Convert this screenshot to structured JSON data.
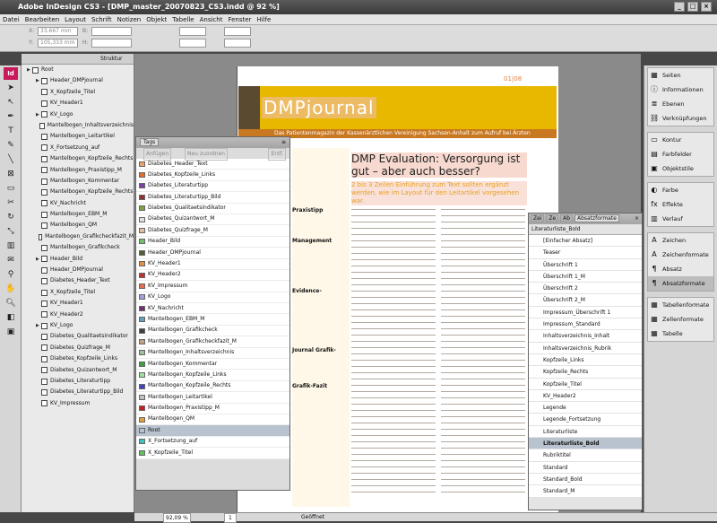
{
  "window": {
    "title": "Adobe InDesign CS3 - [DMP_master_20070823_CS3.indd @ 92 %]"
  },
  "menu": [
    "Datei",
    "Bearbeiten",
    "Layout",
    "Schrift",
    "Notizen",
    "Objekt",
    "Tabelle",
    "Ansicht",
    "Fenster",
    "Hilfe"
  ],
  "control": {
    "x_label": "X:",
    "x_value": "33,667 mm",
    "y_label": "Y:",
    "y_value": "105,333 mm",
    "b_label": "B:",
    "h_label": "H:"
  },
  "structure": {
    "header": "Struktur",
    "items": [
      {
        "label": "Root",
        "level": 0,
        "expand": true
      },
      {
        "label": "Header_DMPjournal",
        "level": 1,
        "expand": true
      },
      {
        "label": "X_Kopfzeile_Titel",
        "level": 1,
        "expand": false
      },
      {
        "label": "KV_Header1",
        "level": 1,
        "expand": false
      },
      {
        "label": "KV_Logo",
        "level": 1,
        "expand": true
      },
      {
        "label": "Mantelbogen_Inhaltsverzeichnis",
        "level": 1,
        "expand": false
      },
      {
        "label": "Mantelbogen_Leitartikel",
        "level": 1,
        "expand": false
      },
      {
        "label": "X_Fortsetzung_auf",
        "level": 1,
        "expand": false
      },
      {
        "label": "Mantelbogen_Kopfzeile_Rechts",
        "level": 1,
        "expand": false
      },
      {
        "label": "Mantelbogen_Praxistipp_M",
        "level": 1,
        "expand": false
      },
      {
        "label": "Mantelbogen_Kommentar",
        "level": 1,
        "expand": false
      },
      {
        "label": "Mantelbogen_Kopfzeile_Rechts",
        "level": 1,
        "expand": false
      },
      {
        "label": "KV_Nachricht",
        "level": 1,
        "expand": false
      },
      {
        "label": "Mantelbogen_EBM_M",
        "level": 1,
        "expand": false
      },
      {
        "label": "Mantelbogen_QM",
        "level": 1,
        "expand": false
      },
      {
        "label": "Mantelbogen_Grafikcheckfazit_M",
        "level": 1,
        "expand": false
      },
      {
        "label": "Mantelbogen_Grafikcheck",
        "level": 1,
        "expand": false
      },
      {
        "label": "Header_Bild",
        "level": 1,
        "expand": true
      },
      {
        "label": "Header_DMPjournal",
        "level": 1,
        "expand": false
      },
      {
        "label": "Diabetes_Header_Text",
        "level": 1,
        "expand": false
      },
      {
        "label": "X_Kopfzeile_Titel",
        "level": 1,
        "expand": false
      },
      {
        "label": "KV_Header1",
        "level": 1,
        "expand": false
      },
      {
        "label": "KV_Header2",
        "level": 1,
        "expand": false
      },
      {
        "label": "KV_Logo",
        "level": 1,
        "expand": true
      },
      {
        "label": "Diabetes_Qualitaetsindikator",
        "level": 1,
        "expand": false
      },
      {
        "label": "Diabetes_Quizfrage_M",
        "level": 1,
        "expand": false
      },
      {
        "label": "Diabetes_Kopfzeile_Links",
        "level": 1,
        "expand": false
      },
      {
        "label": "Diabetes_Quizantwort_M",
        "level": 1,
        "expand": false
      },
      {
        "label": "Diabetes_Literaturtipp",
        "level": 1,
        "expand": false
      },
      {
        "label": "Diabetes_Literaturtipp_Bild",
        "level": 1,
        "expand": false
      },
      {
        "label": "KV_Impressum",
        "level": 1,
        "expand": false
      }
    ]
  },
  "tags": {
    "title": "Tags",
    "add_label": "Anfügen",
    "new_label": "Neu zuordnen",
    "remove_label": "Entf.",
    "items": [
      {
        "label": "Diabetes_Header_Text",
        "color": "#e8a070"
      },
      {
        "label": "Diabetes_Kopfzeile_Links",
        "color": "#e07030"
      },
      {
        "label": "Diabetes_Literaturtipp",
        "color": "#8040a0"
      },
      {
        "label": "Diabetes_Literaturtipp_Bild",
        "color": "#903030"
      },
      {
        "label": "Diabetes_Qualitaetsindikator",
        "color": "#80a040"
      },
      {
        "label": "Diabetes_Quizantwort_M",
        "color": "#e0e0e0"
      },
      {
        "label": "Diabetes_Quizfrage_M",
        "color": "#e0c0a0"
      },
      {
        "label": "Header_Bild",
        "color": "#70c070"
      },
      {
        "label": "Header_DMPjournal",
        "color": "#506030"
      },
      {
        "label": "KV_Header1",
        "color": "#e09040"
      },
      {
        "label": "KV_Header2",
        "color": "#c03030"
      },
      {
        "label": "KV_Impressum",
        "color": "#e07050"
      },
      {
        "label": "KV_Logo",
        "color": "#a0a0e0"
      },
      {
        "label": "KV_Nachricht",
        "color": "#703070"
      },
      {
        "label": "Mantelbogen_EBM_M",
        "color": "#60a0c0"
      },
      {
        "label": "Mantelbogen_Grafikcheck",
        "color": "#404040"
      },
      {
        "label": "Mantelbogen_Grafikcheckfazit_M",
        "color": "#c0a080"
      },
      {
        "label": "Mantelbogen_Inhaltsverzeichnis",
        "color": "#a0c0a0"
      },
      {
        "label": "Mantelbogen_Kommentar",
        "color": "#40a040"
      },
      {
        "label": "Mantelbogen_Kopfzeile_Links",
        "color": "#a0e0a0"
      },
      {
        "label": "Mantelbogen_Kopfzeile_Rechts",
        "color": "#4040c0"
      },
      {
        "label": "Mantelbogen_Leitartikel",
        "color": "#c0c0c0"
      },
      {
        "label": "Mantelbogen_Praxistipp_M",
        "color": "#c02020"
      },
      {
        "label": "Mantelbogen_QM",
        "color": "#e0a040"
      },
      {
        "label": "Root",
        "color": "#b8c3cf"
      },
      {
        "label": "X_Fortsetzung_auf",
        "color": "#40c0c0"
      },
      {
        "label": "X_Kopfzeile_Titel",
        "color": "#60c060"
      }
    ]
  },
  "document": {
    "logo_text": "DMPjournal",
    "page_num": "01|08",
    "band_text": "Das Patientenmagazin der Kassenärztlichen Vereinigung Sachsen-Anhalt zum Aufruf bei Ärzten",
    "headline": "DMP Evaluation: Versorgung ist gut – aber auch besser?",
    "subhead": "2 bis 3 Zeilen Einführung zum Text sollten ergänzt werden, wie im Layout für den Leitartikel vorgesehen war.",
    "side_labels": [
      "Praxistipp",
      "Management",
      "Evidence-",
      "Journal Grafik-",
      "Grafik-Fazit"
    ]
  },
  "absatzformate": {
    "tab1": "Zei",
    "tab2": "Ze",
    "tab3": "Ab",
    "title": "Absatzformate",
    "current": "Literaturliste_Bold",
    "items": [
      {
        "label": "[Einfacher Absatz]",
        "selected": false
      },
      {
        "label": "Teaser",
        "selected": false
      },
      {
        "label": "Überschrift 1",
        "selected": false
      },
      {
        "label": "Überschrift 1_M",
        "selected": false
      },
      {
        "label": "Überschrift 2",
        "selected": false
      },
      {
        "label": "Überschrift 2_M",
        "selected": false
      },
      {
        "label": "Impressum_Überschrift 1",
        "selected": false
      },
      {
        "label": "Impressum_Standard",
        "selected": false
      },
      {
        "label": "Inhaltsverzeichnis_Inhalt",
        "selected": false
      },
      {
        "label": "Inhaltsverzeichnis_Rubrik",
        "selected": false
      },
      {
        "label": "Kopfzeile_Links",
        "selected": false
      },
      {
        "label": "Kopfzeile_Rechts",
        "selected": false
      },
      {
        "label": "Kopfzeile_Titel",
        "selected": false
      },
      {
        "label": "KV_Header2",
        "selected": false
      },
      {
        "label": "Legende",
        "selected": false
      },
      {
        "label": "Legende_Fortsetzung",
        "selected": false
      },
      {
        "label": "Literaturliste",
        "selected": false
      },
      {
        "label": "Literaturliste_Bold",
        "selected": true
      },
      {
        "label": "Rubriktitel",
        "selected": false
      },
      {
        "label": "Standard",
        "selected": false
      },
      {
        "label": "Standard_Bold",
        "selected": false
      },
      {
        "label": "Standard_M",
        "selected": false
      }
    ]
  },
  "panels": [
    {
      "items": [
        {
          "label": "Seiten",
          "icon": "▦"
        },
        {
          "label": "Informationen",
          "icon": "ⓘ"
        },
        {
          "label": "Ebenen",
          "icon": "≣"
        },
        {
          "label": "Verknüpfungen",
          "icon": "⛓"
        }
      ]
    },
    {
      "items": [
        {
          "label": "Kontur",
          "icon": "▭"
        },
        {
          "label": "Farbfelder",
          "icon": "▤"
        },
        {
          "label": "Objektstile",
          "icon": "▣"
        }
      ]
    },
    {
      "items": [
        {
          "label": "Farbe",
          "icon": "◐"
        },
        {
          "label": "Effekte",
          "icon": "fx"
        },
        {
          "label": "Verlauf",
          "icon": "▥"
        }
      ]
    },
    {
      "items": [
        {
          "label": "Zeichen",
          "icon": "A"
        },
        {
          "label": "Zeichenformate",
          "icon": "A"
        },
        {
          "label": "Absatz",
          "icon": "¶"
        },
        {
          "label": "Absatzformate",
          "icon": "¶",
          "selected": true
        }
      ]
    },
    {
      "items": [
        {
          "label": "Tabellenformate",
          "icon": "▦"
        },
        {
          "label": "Zellenformate",
          "icon": "▦"
        },
        {
          "label": "Tabelle",
          "icon": "▦"
        }
      ]
    }
  ],
  "status": {
    "zoom": "92,09 %",
    "page": "1",
    "state": "Geöffnet"
  }
}
